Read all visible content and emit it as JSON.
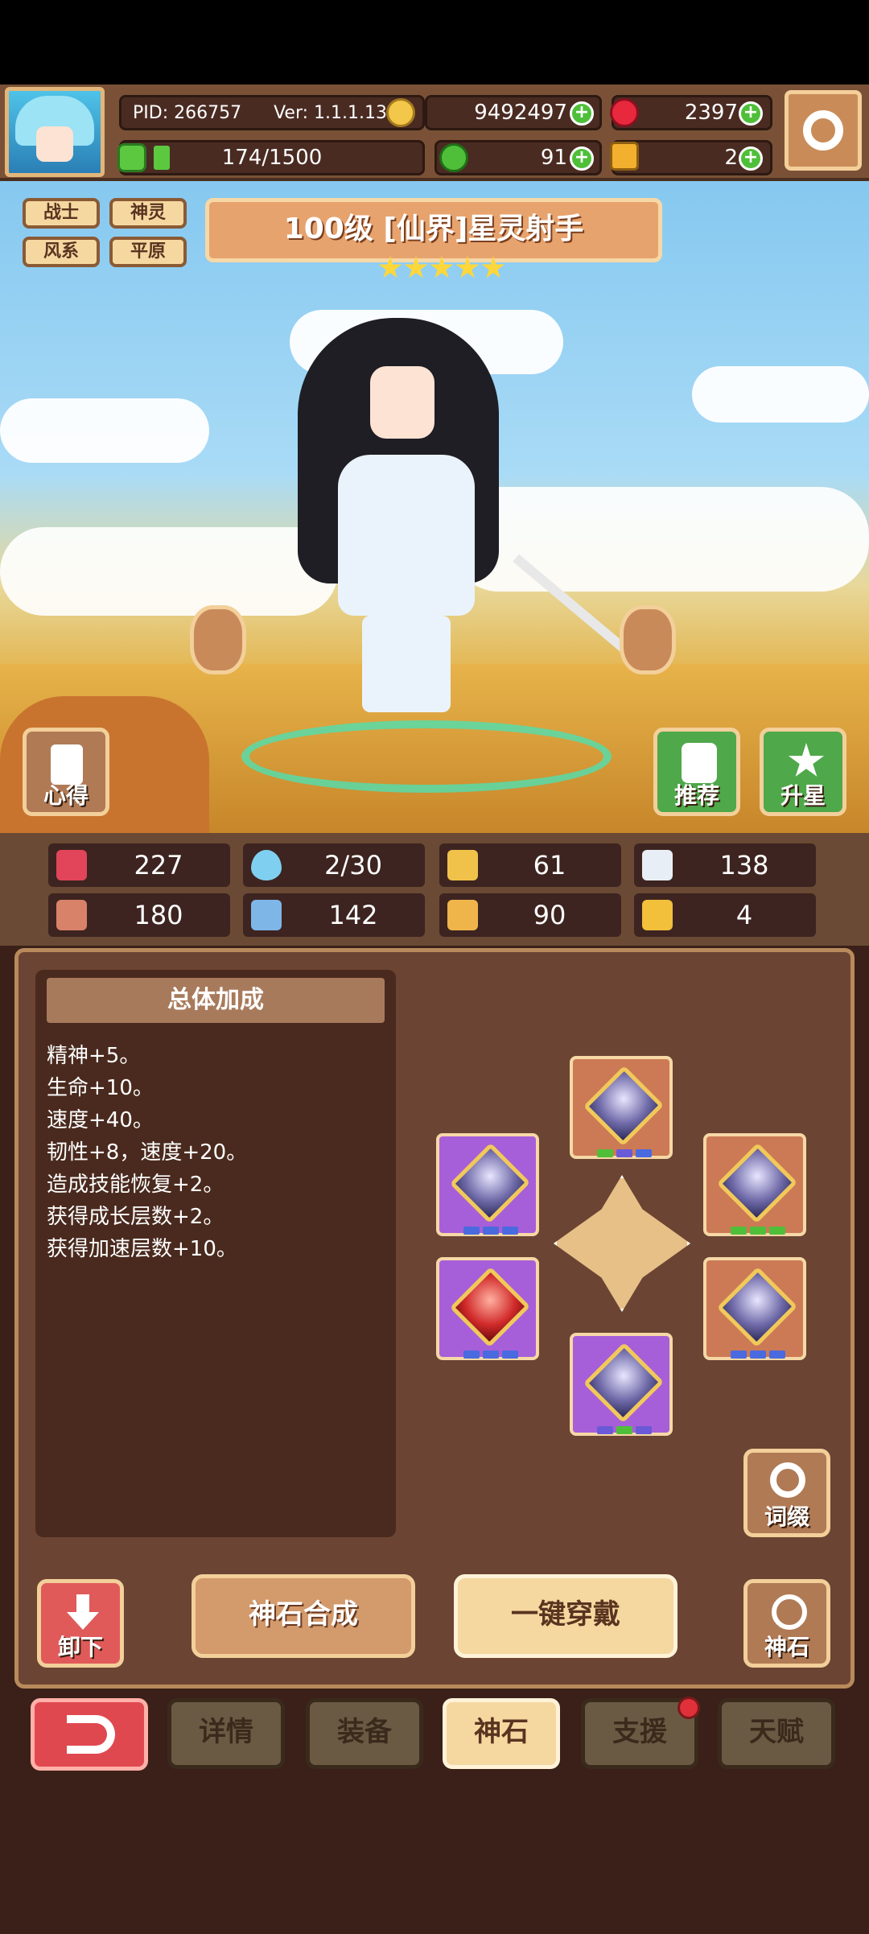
{
  "player": {
    "pid": "PID: 266757",
    "version": "Ver: 1.1.1.13",
    "exp": "174/1500"
  },
  "currency": {
    "gold": "9492497",
    "ruby": "2397",
    "clover": "91",
    "trophy": "2"
  },
  "hero": {
    "title": "100级 [仙界]星灵射手",
    "tags": [
      "战士",
      "神灵",
      "风系",
      "平原"
    ],
    "stars": 5
  },
  "buttons": {
    "insight": "心得",
    "recommend": "推荐",
    "star_up": "升星",
    "affix": "词缀",
    "unload": "卸下",
    "synthesize": "神石合成",
    "equip_all": "一键穿戴",
    "godstone": "神石"
  },
  "stats": [
    {
      "icon": "heart-icon",
      "value": "227",
      "color": "#e2455a"
    },
    {
      "icon": "mana-drop-icon",
      "value": "2/30",
      "color": "#7fd0f0"
    },
    {
      "icon": "shield-icon",
      "value": "61",
      "color": "#f1c24a"
    },
    {
      "icon": "wing-icon",
      "value": "138",
      "color": "#e8eef6"
    },
    {
      "icon": "fist-icon",
      "value": "180",
      "color": "#d9826a"
    },
    {
      "icon": "book-icon",
      "value": "142",
      "color": "#7fb6e8"
    },
    {
      "icon": "boot-icon",
      "value": "90",
      "color": "#f0b54a"
    },
    {
      "icon": "horseshoe-icon",
      "value": "4",
      "color": "#f2c03a"
    }
  ],
  "bonus": {
    "header": "总体加成",
    "lines": [
      "精神+5。",
      "生命+10。",
      "速度+40。",
      "韧性+8，速度+20。",
      "造成技能恢复+2。",
      "获得成长层数+2。",
      "获得加速层数+10。"
    ]
  },
  "tabs": [
    "详情",
    "装备",
    "神石",
    "支援",
    "天赋"
  ],
  "active_tab": "神石"
}
